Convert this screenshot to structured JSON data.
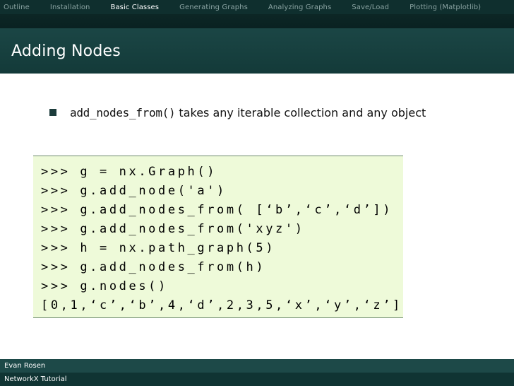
{
  "nav": {
    "items": [
      {
        "label": "Outline"
      },
      {
        "label": "Installation"
      },
      {
        "label": "Basic Classes"
      },
      {
        "label": "Generating Graphs"
      },
      {
        "label": "Analyzing Graphs"
      },
      {
        "label": "Save/Load"
      },
      {
        "label": "Plotting (Matplotlib)"
      }
    ],
    "active_index": 2
  },
  "slide": {
    "title": "Adding Nodes",
    "bullet": {
      "code": "add_nodes_from()",
      "text": " takes any iterable collection and any object"
    },
    "code_lines": [
      ">>> g = nx.Graph()",
      ">>> g.add_node('a')",
      ">>> g.add_nodes_from( [‘b’,‘c’,‘d’])",
      ">>> g.add_nodes_from('xyz')",
      ">>> h = nx.path_graph(5)",
      ">>> g.add_nodes_from(h)",
      ">>> g.nodes()",
      "[0,1,‘c’,‘b’,4,‘d’,2,3,5,‘x’,‘y’,‘z’]"
    ]
  },
  "footer": {
    "author": "Evan Rosen",
    "short_title": "NetworkX Tutorial"
  },
  "colors": {
    "nav_bg": "#0f2f2e",
    "title_bg": "#1b4645",
    "code_bg": "#eefad9",
    "footer_top": "#1d4948",
    "footer_bottom": "#103433"
  }
}
